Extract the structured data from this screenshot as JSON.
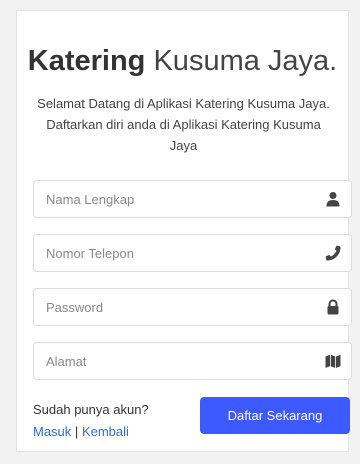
{
  "header": {
    "title_bold": "Katering",
    "title_light": "Kusuma Jaya.",
    "welcome_text": "Selamat Datang di Aplikasi Katering Kusuma Jaya. Daftarkan diri anda di Aplikasi Katering Kusuma Jaya"
  },
  "form": {
    "fields": [
      {
        "placeholder": "Nama Lengkap",
        "value": "",
        "icon": "user-icon"
      },
      {
        "placeholder": "Nomor Telepon",
        "value": "",
        "icon": "phone-icon"
      },
      {
        "placeholder": "Password",
        "value": "",
        "icon": "lock-icon"
      },
      {
        "placeholder": "Alamat",
        "value": "",
        "icon": "map-icon"
      }
    ],
    "submit_label": "Daftar Sekarang"
  },
  "footer": {
    "have_account_text": "Sudah punya akun?",
    "login_link": "Masuk",
    "separator": "|",
    "back_link": "Kembali"
  },
  "colors": {
    "primary_button": "#3d5afe",
    "link": "#2f6fd6",
    "icon": "#444444"
  }
}
